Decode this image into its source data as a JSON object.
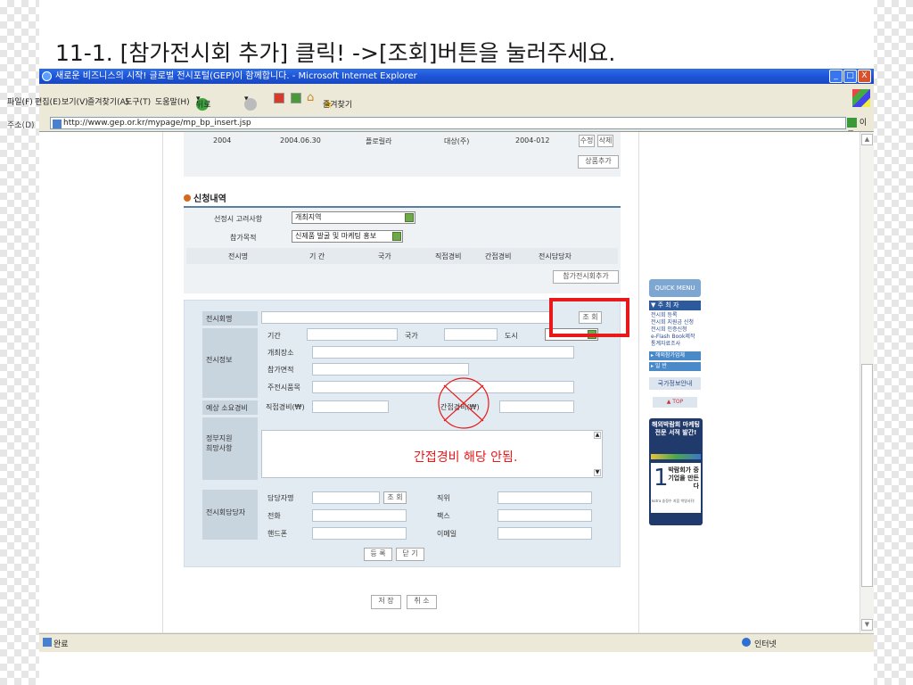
{
  "slide_title": "11-1. [참가전시회 추가] 클릭! ->[조회]버튼을 눌러주세요.",
  "window": {
    "title": "새로운 비즈니스의 시작! 글로벌 전시포털(GEP)이 함께합니다. - Microsoft Internet Explorer",
    "minimize": "_",
    "maximize": "□",
    "close": "X"
  },
  "menu": [
    "파일(F)",
    "편집(E)",
    "보기(V)",
    "즐겨찾기(A)",
    "도구(T)",
    "도움말(H)"
  ],
  "toolbar": {
    "back": "뒤로",
    "favorites": "즐겨찾기"
  },
  "address": {
    "label": "주소(D)",
    "url": "http://www.gep.or.kr/mypage/mp_bp_insert.jsp",
    "go": "이동"
  },
  "top_row": {
    "year": "2004",
    "date": "2004.06.30",
    "product": "플로릴라",
    "company": "대상(주)",
    "code": "2004-012",
    "edit": "수정",
    "delete": "삭제",
    "add_product": "상품추가"
  },
  "application": {
    "heading": "신청내역",
    "consideration_label": "선정시 고려사항",
    "consideration_value": "개최지역",
    "purpose_label": "참가목적",
    "purpose_value": "신제품 발굴 및 마케팅 홍보",
    "columns": [
      "전시명",
      "기 간",
      "국가",
      "직접경비",
      "간접경비",
      "전시담당자"
    ],
    "add_exhibition": "참가전시회추가"
  },
  "form": {
    "exhibition_name": "전시회명",
    "search": "조 회",
    "exhibition_info": "전시정보",
    "period": "기간",
    "country": "국가",
    "city": "도시",
    "venue": "개최장소",
    "area": "참가면적",
    "main_items": "주전시품목",
    "expected_cost": "예상 소요경비",
    "direct_cost": "직접경비(₩)",
    "indirect_cost": "간접경비(₩)",
    "gov_support": "정부지원\n희망사항",
    "manager_section": "전시회담당자",
    "manager_name": "담당자명",
    "manager_search": "조 회",
    "position": "직위",
    "phone": "전화",
    "fax": "팩스",
    "mobile": "핸드폰",
    "email": "이메일",
    "register": "등 록",
    "close": "닫 기"
  },
  "annotation": "간접경비 해당 안됨.",
  "bottom": {
    "save": "저 장",
    "cancel": "취 소"
  },
  "quick_menu": {
    "title": "QUICK MENU",
    "section": "▼ 주 최 자",
    "items": [
      "전시회 등록",
      "전시회 지원금 신청",
      "전시회 인증신청",
      "e-Flash Book제작",
      "통계자료조사"
    ],
    "overseas": "▸ 해외참가업체",
    "inquiry": "▸ 일 반",
    "country_info": "국가정보안내",
    "top": "▲ TOP",
    "ad_title": "해외박람회 마케팅 전문 서적 발간!",
    "ad_number": "1",
    "ad_text": "박람회가 중기업을 만든다",
    "ad_footer": "kotra 송정수 지음 박영사刊"
  },
  "status": {
    "done": "완료",
    "zone": "인터넷"
  },
  "colors": {
    "highlight_box": "#e8191a",
    "annotation": "#e8191a",
    "titlebar": "#1e55d8"
  }
}
